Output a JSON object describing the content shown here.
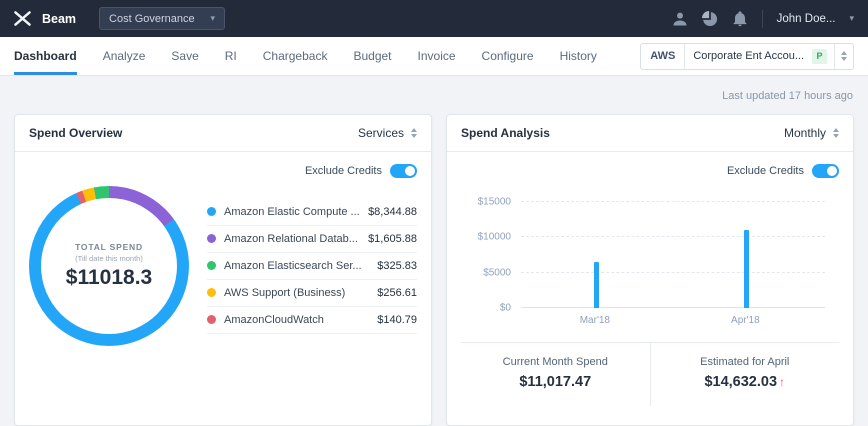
{
  "topbar": {
    "brand": "Beam",
    "product_dropdown": "Cost Governance",
    "user": "John Doe...",
    "icons": [
      "user-icon",
      "pie-chart-icon",
      "bell-icon"
    ]
  },
  "nav": {
    "tabs": [
      {
        "label": "Dashboard",
        "active": true
      },
      {
        "label": "Analyze",
        "active": false
      },
      {
        "label": "Save",
        "active": false
      },
      {
        "label": "RI",
        "active": false
      },
      {
        "label": "Chargeback",
        "active": false
      },
      {
        "label": "Budget",
        "active": false
      },
      {
        "label": "Invoice",
        "active": false
      },
      {
        "label": "Configure",
        "active": false
      },
      {
        "label": "History",
        "active": false
      }
    ],
    "account_selector": {
      "provider": "AWS",
      "account": "Corporate Ent Accou...",
      "badge": "P"
    }
  },
  "main": {
    "last_updated": "Last updated 17 hours ago",
    "spend_overview": {
      "title": "Spend Overview",
      "dropdown_label": "Services",
      "toggle_label": "Exclude Credits",
      "toggle_on": true,
      "donut_center": {
        "label": "TOTAL SPEND",
        "sublabel": "(Till date this month)",
        "value": "$11018.3"
      },
      "legend": [
        {
          "name": "Amazon Elastic Compute ...",
          "value": "$8,344.88"
        },
        {
          "name": "Amazon Relational Datab...",
          "value": "$1,605.88"
        },
        {
          "name": "Amazon Elasticsearch Ser...",
          "value": "$325.83"
        },
        {
          "name": "AWS Support (Business)",
          "value": "$256.61"
        },
        {
          "name": "AmazonCloudWatch",
          "value": "$140.79"
        }
      ]
    },
    "spend_analysis": {
      "title": "Spend Analysis",
      "dropdown_label": "Monthly",
      "toggle_label": "Exclude Credits",
      "toggle_on": true,
      "stats": [
        {
          "label": "Current Month Spend",
          "value": "$11,017.47",
          "trend": ""
        },
        {
          "label": "Estimated for April",
          "value": "$14,632.03",
          "trend": "↑"
        }
      ]
    }
  },
  "colors": {
    "accent_blue": "#23a6f7",
    "topbar_bg": "#232b3a",
    "positive_green": "#2fa86b",
    "alert_red": "#e4606d"
  },
  "chart_data": [
    {
      "type": "pie",
      "title": "Spend Overview donut",
      "labels": [
        "Amazon Elastic Compute",
        "Amazon Relational Database",
        "Amazon Elasticsearch Service",
        "AWS Support (Business)",
        "AmazonCloudWatch"
      ],
      "values": [
        8344.88,
        1605.88,
        325.83,
        256.61,
        140.79
      ],
      "colors": [
        "#23a6f7",
        "#8b63d6",
        "#2fc46e",
        "#ffbe0a",
        "#e4606d"
      ],
      "center_total": 11018.3,
      "legend_position": "right"
    },
    {
      "type": "bar",
      "title": "Spend Analysis monthly",
      "categories": [
        "Mar'18",
        "Apr'18"
      ],
      "values": [
        6500,
        11017
      ],
      "ylim": [
        0,
        15000
      ],
      "ytick_labels": [
        "$0",
        "$5000",
        "$10000",
        "$15000"
      ],
      "bar_color": "#23a6f7",
      "grid": "dashed"
    }
  ]
}
